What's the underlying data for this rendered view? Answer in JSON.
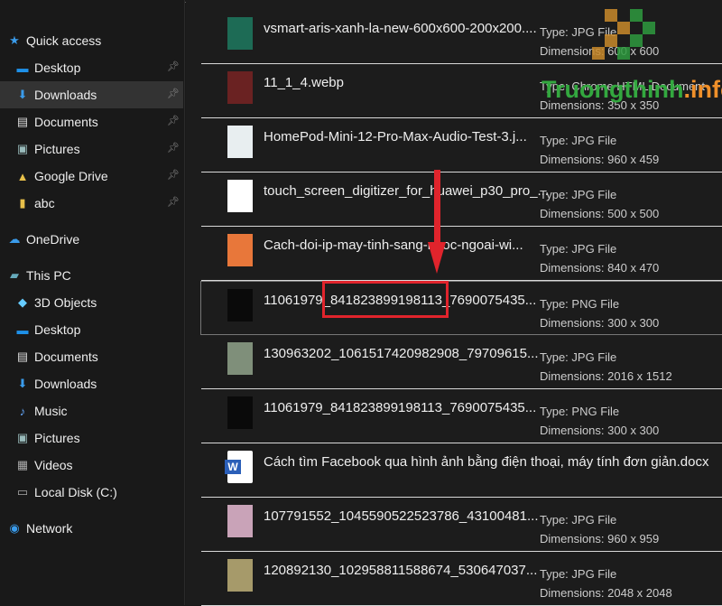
{
  "sidebar": {
    "items": [
      {
        "label": "Quick access",
        "icon": "star-icon",
        "color": "#3a9bea",
        "pinned": false,
        "indent": false,
        "selected": false
      },
      {
        "label": "Desktop",
        "icon": "desktop-icon",
        "color": "#1e90e8",
        "pinned": true,
        "indent": true,
        "selected": false
      },
      {
        "label": "Downloads",
        "icon": "download-icon",
        "color": "#3a9bea",
        "pinned": true,
        "indent": true,
        "selected": true
      },
      {
        "label": "Documents",
        "icon": "document-icon",
        "color": "#ddd",
        "pinned": true,
        "indent": true,
        "selected": false
      },
      {
        "label": "Pictures",
        "icon": "pictures-icon",
        "color": "#9bb",
        "pinned": true,
        "indent": true,
        "selected": false
      },
      {
        "label": "Google Drive",
        "icon": "google-drive-icon",
        "color": "#e8c04a",
        "pinned": true,
        "indent": true,
        "selected": false
      },
      {
        "label": "abc",
        "icon": "folder-icon",
        "color": "#e8c04a",
        "pinned": true,
        "indent": true,
        "selected": false
      },
      {
        "label": "OneDrive",
        "icon": "cloud-icon",
        "color": "#3a9bea",
        "pinned": false,
        "indent": false,
        "selected": false,
        "gap": true
      },
      {
        "label": "This PC",
        "icon": "computer-icon",
        "color": "#6ab",
        "pinned": false,
        "indent": false,
        "selected": false,
        "gap": true
      },
      {
        "label": "3D Objects",
        "icon": "cube-icon",
        "color": "#6cf",
        "pinned": false,
        "indent": true,
        "selected": false
      },
      {
        "label": "Desktop",
        "icon": "desktop-icon",
        "color": "#1e90e8",
        "pinned": false,
        "indent": true,
        "selected": false
      },
      {
        "label": "Documents",
        "icon": "document-icon",
        "color": "#ddd",
        "pinned": false,
        "indent": true,
        "selected": false
      },
      {
        "label": "Downloads",
        "icon": "download-icon",
        "color": "#3a9bea",
        "pinned": false,
        "indent": true,
        "selected": false
      },
      {
        "label": "Music",
        "icon": "music-icon",
        "color": "#6af",
        "pinned": false,
        "indent": true,
        "selected": false
      },
      {
        "label": "Pictures",
        "icon": "pictures-icon",
        "color": "#9bb",
        "pinned": false,
        "indent": true,
        "selected": false
      },
      {
        "label": "Videos",
        "icon": "video-icon",
        "color": "#aaa",
        "pinned": false,
        "indent": true,
        "selected": false
      },
      {
        "label": "Local Disk (C:)",
        "icon": "disk-icon",
        "color": "#aaa",
        "pinned": false,
        "indent": true,
        "selected": false
      },
      {
        "label": "Network",
        "icon": "network-icon",
        "color": "#3a9bea",
        "pinned": false,
        "indent": false,
        "selected": false,
        "gap": true
      }
    ]
  },
  "files": [
    {
      "name": "vsmart-aris-xanh-la-new-600x600-200x200....",
      "type": "Type: JPG File",
      "dims": "Dimensions: 600 x 600",
      "thumb": "#1d6b55"
    },
    {
      "name": "11_1_4.webp",
      "type": "Type: Chrome HTML Document",
      "dims": "Dimensions: 350 x 350",
      "thumb": "#6a2222"
    },
    {
      "name": "HomePod-Mini-12-Pro-Max-Audio-Test-3.j...",
      "type": "Type: JPG File",
      "dims": "Dimensions: 960 x 459",
      "thumb": "#e8eef0"
    },
    {
      "name": "touch_screen_digitizer_for_huawei_p30_pro_...",
      "type": "Type: JPG File",
      "dims": "Dimensions: 500 x 500",
      "thumb": "#ffffff"
    },
    {
      "name": "Cach-doi-ip-may-tinh-sang-nuoc-ngoai-wi...",
      "type": "Type: JPG File",
      "dims": "Dimensions: 840 x 470",
      "thumb": "#e8773a"
    },
    {
      "name": "11061979_841823899198113_7690075435...",
      "type": "Type: PNG File",
      "dims": "Dimensions: 300 x 300",
      "thumb": "#0a0a0a",
      "selected": true
    },
    {
      "name": "130963202_1061517420982908_79709615...",
      "type": "Type: JPG File",
      "dims": "Dimensions: 2016 x 1512",
      "thumb": "#7f8f7a"
    },
    {
      "name": "11061979_841823899198113_7690075435...",
      "type": "Type: PNG File",
      "dims": "Dimensions: 300 x 300",
      "thumb": "#0a0a0a"
    },
    {
      "name": "Cách tìm Facebook qua hình ảnh bằng điện thoại, máy tính đơn giản.docx",
      "type": "",
      "dims": "",
      "thumb": "word",
      "icon": "word-doc-icon"
    },
    {
      "name": "107791552_1045590522523786_43100481...",
      "type": "Type: JPG File",
      "dims": "Dimensions: 960 x 959",
      "thumb": "#c9a3b8"
    },
    {
      "name": "120892130_102958811588674_530647037...",
      "type": "Type: JPG File",
      "dims": "Dimensions: 2048 x 2048",
      "thumb": "#a69a6a"
    }
  ],
  "watermark": {
    "text_green": "Truongthinh",
    "text_orange": ".info"
  },
  "colors": {
    "highlight": "#e0242c",
    "selection": "#333333"
  }
}
